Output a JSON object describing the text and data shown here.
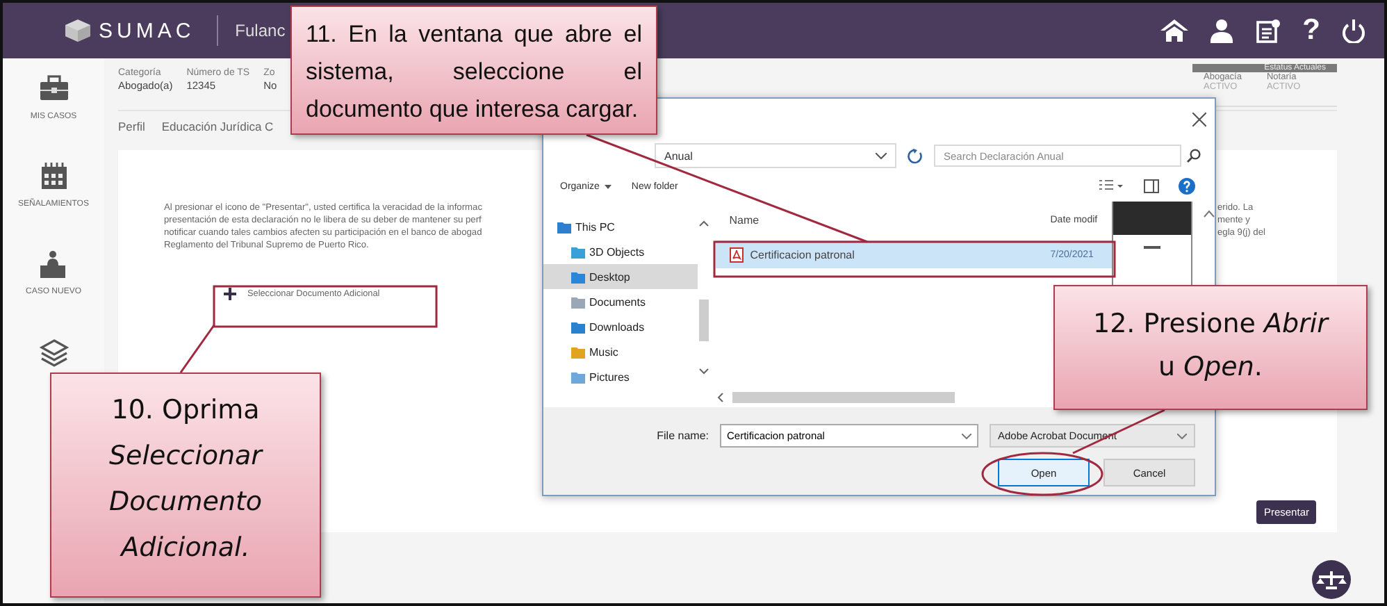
{
  "header": {
    "logo": "SUMAC",
    "user": "Fulanc",
    "icons": [
      {
        "kind": "home"
      },
      {
        "kind": "user"
      },
      {
        "kind": "document"
      },
      {
        "kind": "help",
        "glyph": "?"
      },
      {
        "kind": "power"
      }
    ]
  },
  "sidebar": {
    "items": [
      {
        "kind": "briefcase",
        "label": "MIS CASOS"
      },
      {
        "kind": "calendar",
        "label": "SEÑALAMIENTOS"
      },
      {
        "kind": "desk",
        "label": "CASO NUEVO"
      },
      {
        "kind": "layers"
      }
    ]
  },
  "profile": {
    "fields": [
      {
        "label": "Categoría",
        "value": "Abogado(a)"
      },
      {
        "label": "Número de TS",
        "value": "12345"
      },
      {
        "label": "Zo",
        "value": "No"
      }
    ]
  },
  "status": {
    "title": "Estatus Actuales",
    "items": [
      {
        "label": "Abogacía",
        "value": "ACTIVO"
      },
      {
        "label": "Notaría",
        "value": "ACTIVO"
      }
    ]
  },
  "tabs": [
    {
      "label": "Perfil",
      "selected": false
    },
    {
      "label": "Educación Jurídica C",
      "selected": false
    }
  ],
  "notice": {
    "lines": [
      "Al presionar el icono de \"Presentar\", usted certifica la veracidad de la informac",
      "presentación de esta declaración no le libera de su deber de mantener su perf",
      "notificar cuando tales cambios afecten su participación en el banco de abogad",
      "Reglamento del Tribunal Supremo de Puerto Rico."
    ],
    "continuation": [
      "erido. La",
      "mente y",
      "egla 9(j) del"
    ]
  },
  "add_document": {
    "label": "Seleccionar Documento Adicional"
  },
  "submit_button": {
    "label": "Presentar"
  },
  "file_dialog": {
    "address": "Anual",
    "search_placeholder": "Search Declaración Anual",
    "toolbar": [
      "Organize",
      "New folder"
    ],
    "nav_items": [
      {
        "label": "This PC",
        "kind": "pc",
        "selected": false
      },
      {
        "label": "3D Objects",
        "kind": "objects",
        "selected": false
      },
      {
        "label": "Desktop",
        "kind": "desktop",
        "selected": true
      },
      {
        "label": "Documents",
        "kind": "documents",
        "selected": false
      },
      {
        "label": "Downloads",
        "kind": "downloads",
        "selected": false
      },
      {
        "label": "Music",
        "kind": "music",
        "selected": false
      },
      {
        "label": "Pictures",
        "kind": "pictures",
        "selected": false
      }
    ],
    "columns": [
      "Name",
      "Date modif"
    ],
    "files": [
      {
        "name": "Certificacion patronal",
        "date": "7/20/2021",
        "selected": true
      }
    ],
    "file_name_label": "File name:",
    "file_name": "Certificacion patronal",
    "file_type": "Adobe Acrobat Document",
    "buttons": [
      {
        "label": "Open",
        "kind": "primary"
      },
      {
        "label": "Cancel",
        "kind": "secondary"
      }
    ]
  },
  "callouts": [
    {
      "kind": "justified",
      "lines": [
        "11. En la ventana que abre el",
        "sistema, seleccione el",
        "documento que interesa cargar."
      ]
    },
    {
      "kind": "centered",
      "lines": [
        "10. Oprima *Seleccionar Documento Adicional.*"
      ]
    },
    {
      "kind": "centered",
      "lines": [
        "12. Presione *Abrir*",
        "u *Open*."
      ]
    }
  ]
}
